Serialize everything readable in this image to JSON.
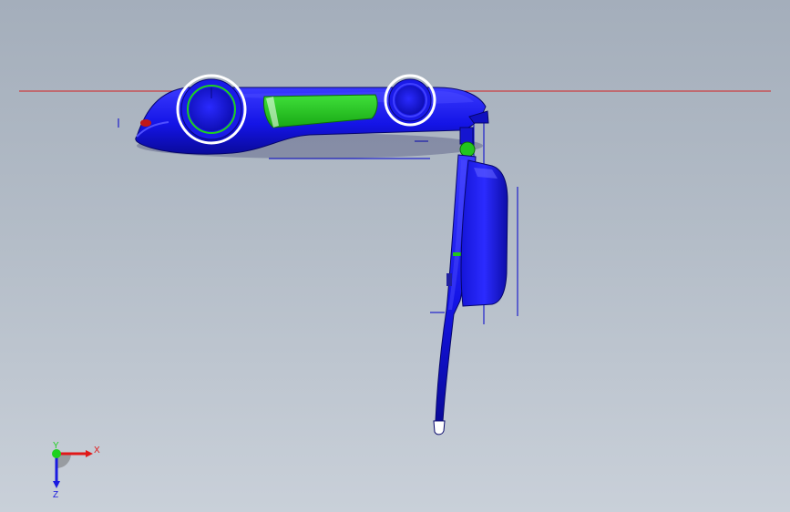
{
  "viewport": {
    "background_top": "#a4aebb",
    "background_bottom": "#c9d0d9"
  },
  "model": {
    "body_color": "#1414e6",
    "highlight_color": "#3c3cff",
    "accent_color": "#22c51e",
    "sketch_line_color": "#0000cc",
    "reference_plane_color": "#d42020",
    "tip_color": "#ffffff"
  },
  "triad": {
    "x_label": "X",
    "y_label": "Y",
    "z_label": "Z",
    "x_color": "#e01818",
    "y_color": "#1fd11f",
    "z_color": "#1a1ae0"
  }
}
